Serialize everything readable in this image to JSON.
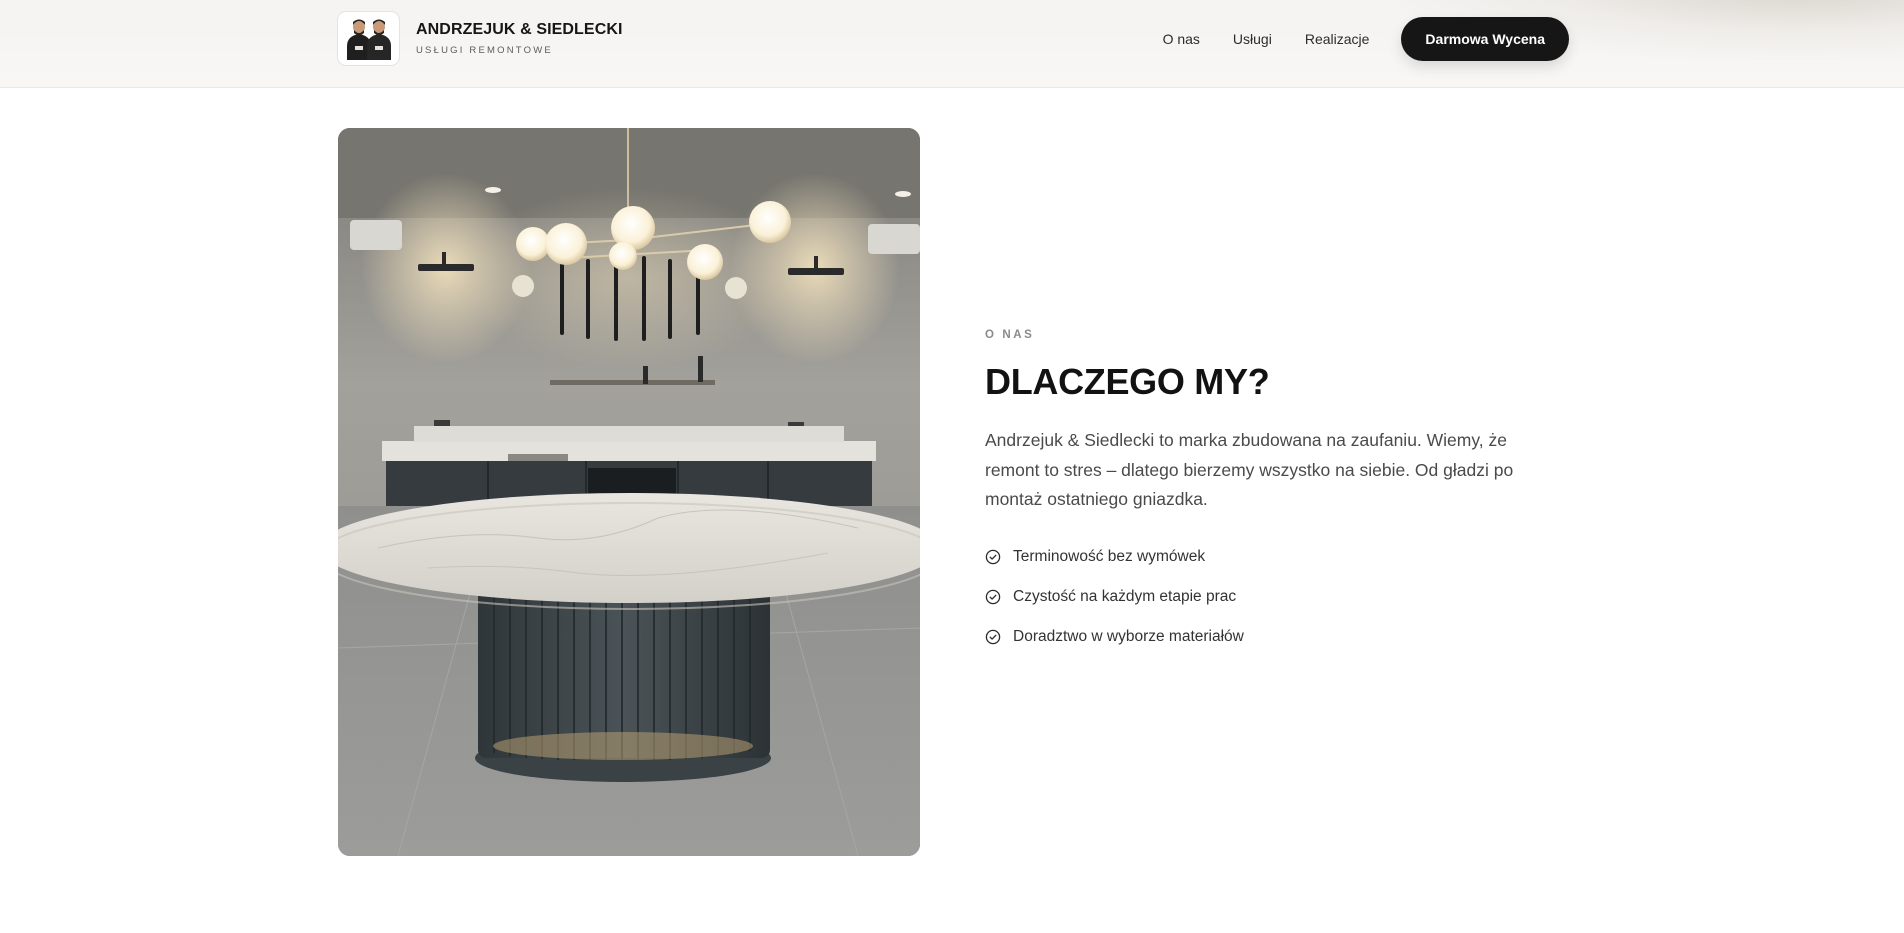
{
  "header": {
    "brand_name": "ANDRZEJUK & SIEDLECKI",
    "brand_tagline": "USŁUGI REMONTOWE",
    "logo_icon": "two-workers-logo",
    "nav": [
      {
        "label": "O nas"
      },
      {
        "label": "Usługi"
      },
      {
        "label": "Realizacje"
      }
    ],
    "cta_label": "Darmowa Wycena"
  },
  "about": {
    "image_icon": "kitchen-interior-photo",
    "eyebrow": "O NAS",
    "title": "DLACZEGO MY?",
    "body": "Andrzejuk & Siedlecki to marka zbudowana na zaufaniu. Wiemy, że remont to stres – dlatego bierzemy wszystko na siebie. Od gładzi po montaż ostatniego gniazdka.",
    "features": [
      {
        "icon": "check-circle-icon",
        "text": "Terminowość bez wymówek"
      },
      {
        "icon": "check-circle-icon",
        "text": "Czystość na każdym etapie prac"
      },
      {
        "icon": "check-circle-icon",
        "text": "Doradztwo w wyborze materiałów"
      }
    ]
  },
  "colors": {
    "cta_background": "#161616",
    "header_background": "#f6f5f3",
    "text_primary": "#121212",
    "text_muted": "#8a8a8a"
  }
}
